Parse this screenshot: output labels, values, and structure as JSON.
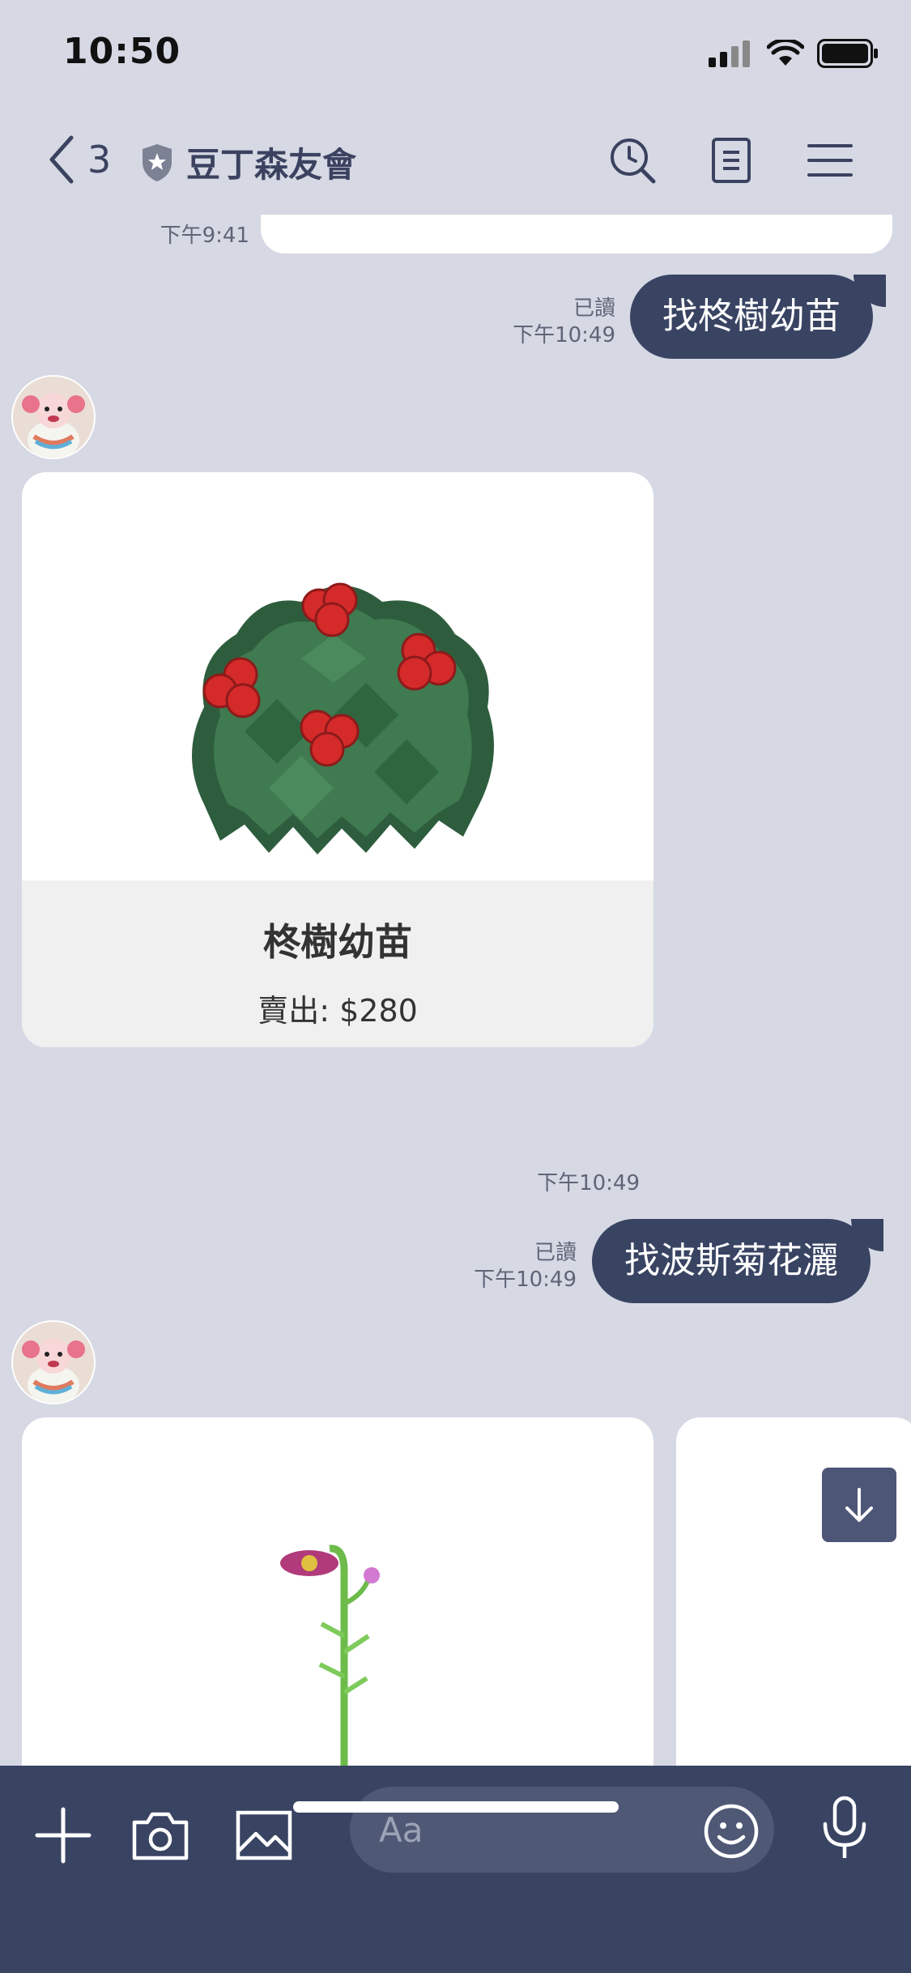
{
  "status_bar": {
    "time": "10:50"
  },
  "header": {
    "back_count": "3",
    "chat_title": "豆丁森友會",
    "icons": [
      "chevron-left-icon",
      "shield-star-icon",
      "search-clock-icon",
      "notes-icon",
      "menu-icon"
    ]
  },
  "messages": {
    "top_meta_time": "下午9:41",
    "msg1": {
      "text": "找柊樹幼苗",
      "read": "已讀",
      "time": "下午10:49"
    },
    "card1": {
      "title": "柊樹幼苗",
      "price": "賣出: $280",
      "time": "下午10:49"
    },
    "msg2": {
      "text": "找波斯菊花灑",
      "read": "已讀",
      "time": "下午10:49"
    }
  },
  "input_bar": {
    "placeholder": "Aa",
    "icons": [
      "plus-icon",
      "camera-icon",
      "image-icon",
      "emoji-icon",
      "microphone-icon"
    ]
  },
  "colors": {
    "background": "#d6d9e4",
    "bubble_out": "#394463",
    "input_bar": "#394463"
  }
}
